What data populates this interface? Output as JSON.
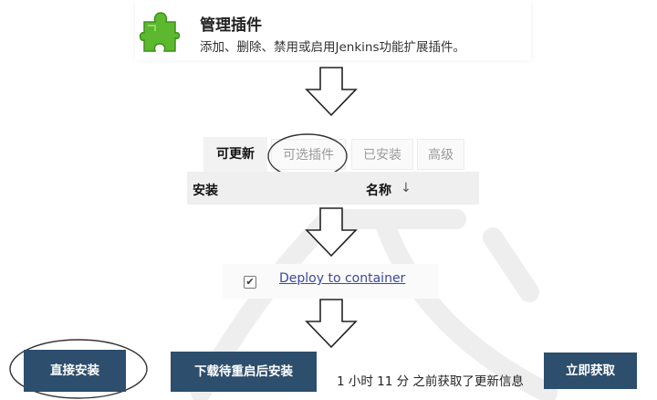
{
  "plugin_card": {
    "title": "管理插件",
    "description": "添加、删除、禁用或启用Jenkins功能扩展插件。",
    "icon": "puzzle-piece-icon"
  },
  "tabs": [
    {
      "label": "可更新",
      "active": true
    },
    {
      "label": "可选插件",
      "active": false,
      "circled": true
    },
    {
      "label": "已安装",
      "active": false
    },
    {
      "label": "高级",
      "active": false
    }
  ],
  "table": {
    "columns": [
      "安装",
      "名称"
    ],
    "sort_indicator": "↓"
  },
  "plugin": {
    "name": "Deploy to container",
    "checked": true
  },
  "bottom": {
    "install_now": "直接安装",
    "install_after_restart": "下载待重启后安装",
    "status": "1 小时 11 分 之前获取了更新信息",
    "fetch_now": "立即获取"
  },
  "colors": {
    "button_bg": "#2d4e6c",
    "link": "#3b4a9a",
    "puzzle_green": "#5cb82e"
  }
}
